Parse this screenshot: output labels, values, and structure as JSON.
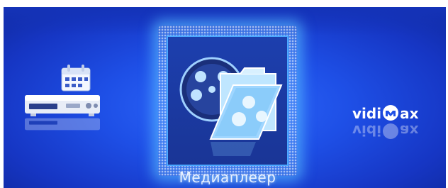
{
  "menu": {
    "items": [
      {
        "id": "recorder-schedule",
        "icon": "recorder-calendar-icon",
        "label": ""
      },
      {
        "id": "media-player",
        "icon": "media-player-icon",
        "label": "Медиаплеер",
        "selected": true
      },
      {
        "id": "vidimax",
        "icon": "vidimax-logo",
        "label": ""
      }
    ]
  },
  "logo": {
    "text": "vidimax",
    "left": "vidi",
    "right": "ax"
  },
  "colors": {
    "background": "#1e4fe6",
    "selection_glow": "#5ab8ff",
    "label": "#e8f2ff"
  }
}
